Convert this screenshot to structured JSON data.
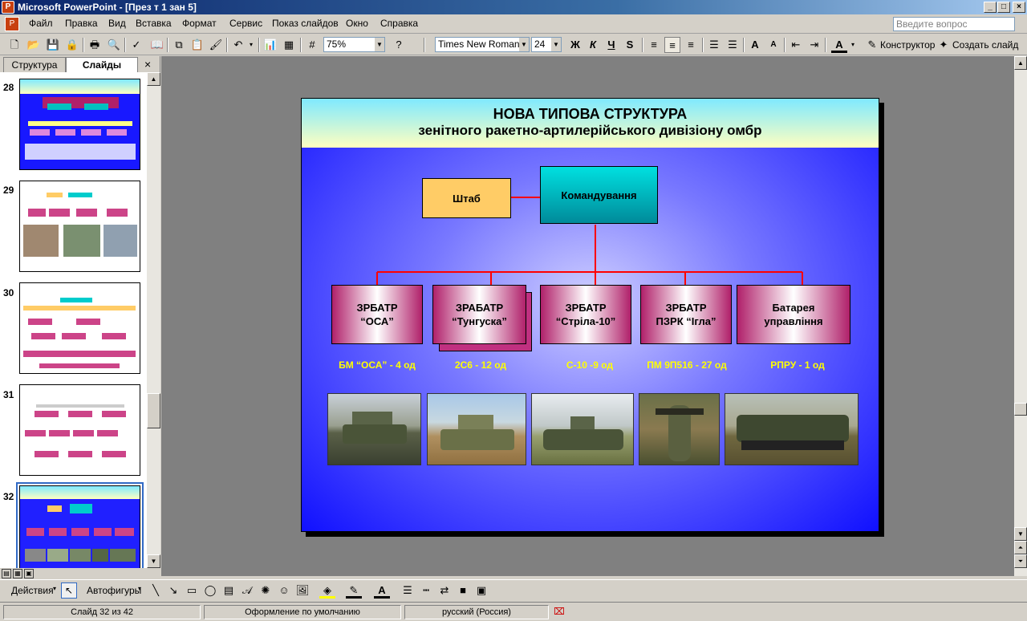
{
  "window": {
    "title": "Microsoft PowerPoint - [През т 1 зан 5]"
  },
  "menu": [
    "Файл",
    "Правка",
    "Вид",
    "Вставка",
    "Формат",
    "Сервис",
    "Показ слайдов",
    "Окно",
    "Справка"
  ],
  "ask_placeholder": "Введите вопрос",
  "toolbar": {
    "zoom": "75%",
    "font": "Times New Roman",
    "size": "24",
    "bold": "Ж",
    "italic": "К",
    "underline": "Ч",
    "shadow": "S",
    "designer": "Конструктор",
    "new_slide": "Создать слайд"
  },
  "panel_tabs": [
    "Структура",
    "Слайды"
  ],
  "thumbnails": [
    {
      "num": "28"
    },
    {
      "num": "29"
    },
    {
      "num": "30"
    },
    {
      "num": "31"
    },
    {
      "num": "32"
    }
  ],
  "slide": {
    "title": "НОВА ТИПОВА СТРУКТУРА",
    "subtitle": "зенітного ракетно-артилерійського дивізіону омбр",
    "hq": "Штаб",
    "command": "Командування",
    "units": [
      {
        "name": "ЗРБАТР\n“ОСА”",
        "eq": "БМ “ОСА” - 4 од"
      },
      {
        "name": "ЗРАБАТР\n“Тунгуска”",
        "eq": "2С6 - 12 од"
      },
      {
        "name": "ЗРБАТР\n“Стріла-10”",
        "eq": "С-10 -9 од"
      },
      {
        "name": "ЗРБАТР\nПЗРК “Ігла”",
        "eq": "ПМ 9П516 - 27 од"
      },
      {
        "name": "Батарея\nуправління",
        "eq": "РПРУ - 1 од"
      }
    ]
  },
  "draw": {
    "actions": "Действия",
    "autoshapes": "Автофигуры"
  },
  "status": {
    "slide": "Слайд 32 из 42",
    "design": "Оформление по умолчанию",
    "lang": "русский (Россия)"
  },
  "colors": {
    "title_bar": "#0a246a",
    "slide_bg": "#1018ff",
    "hq_box": "#ffcc66",
    "command_box": "#00b0b0",
    "connector": "#ff0000",
    "label": "#ffff00"
  }
}
